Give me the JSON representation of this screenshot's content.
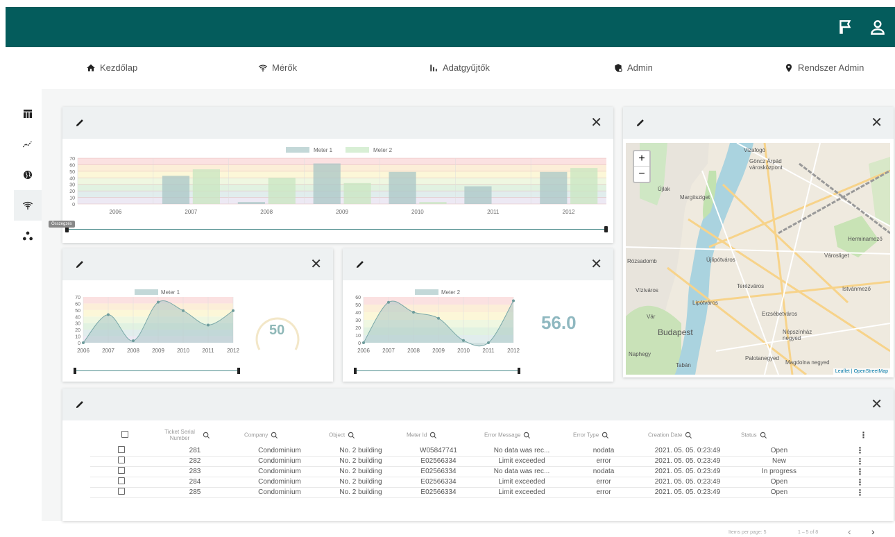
{
  "nav": {
    "items": [
      {
        "label": "Kezdőlap",
        "icon": "home-icon"
      },
      {
        "label": "Mérők",
        "icon": "wifi-signal-icon"
      },
      {
        "label": "Adatgyűjtők",
        "icon": "bar-chart-icon"
      },
      {
        "label": "Admin",
        "icon": "admin-gear-icon"
      },
      {
        "label": "Rendszer Admin",
        "icon": "location-pin-icon"
      }
    ]
  },
  "topbar": {
    "flag_icon": "flag-icon",
    "user_icon": "user-icon"
  },
  "colors": {
    "header": "#045c5c",
    "meter1": "#cfe1e1",
    "meter2": "#d8efd5"
  },
  "bar_card": {
    "slider_tooltip": "Összegzés"
  },
  "chart_data": [
    {
      "type": "bar",
      "categories": [
        "2006",
        "2007",
        "2008",
        "2009",
        "2010",
        "2011",
        "2012"
      ],
      "series": [
        {
          "name": "Meter 1",
          "values": [
            0,
            43,
            3,
            62,
            49,
            27,
            49
          ]
        },
        {
          "name": "Meter 2",
          "values": [
            0,
            53,
            40,
            32,
            3,
            0,
            55
          ]
        }
      ],
      "ylim": [
        0,
        70
      ],
      "yticks": [
        0,
        10,
        20,
        30,
        40,
        50,
        60,
        70
      ],
      "legend": "top-center"
    },
    {
      "type": "area",
      "categories": [
        "2006",
        "2007",
        "2008",
        "2009",
        "2010",
        "2011",
        "2012"
      ],
      "series": [
        {
          "name": "Meter 1",
          "values": [
            0,
            43,
            3,
            62,
            49,
            27,
            49
          ]
        }
      ],
      "ylim": [
        0,
        70
      ],
      "yticks": [
        0,
        10,
        20,
        30,
        40,
        50,
        60,
        70
      ],
      "gauge_value": "50",
      "legend": "top-center"
    },
    {
      "type": "area",
      "categories": [
        "2006",
        "2007",
        "2008",
        "2009",
        "2010",
        "2011",
        "2012"
      ],
      "series": [
        {
          "name": "Meter 2",
          "values": [
            0,
            53,
            40,
            32,
            3,
            0,
            55
          ]
        }
      ],
      "ylim": [
        0,
        60
      ],
      "yticks": [
        0,
        10,
        20,
        30,
        40,
        50,
        60
      ],
      "big_value": "56.0",
      "legend": "top-center"
    }
  ],
  "map": {
    "zoom_in": "+",
    "zoom_out": "−",
    "attribution": "Leaflet | OpenStreetMap",
    "labels": [
      "Vizafogó",
      "Göncz Árpád városközpont",
      "Újlak",
      "Margitsziget",
      "Újlipótváros",
      "Herminamező",
      "Városliget",
      "Terézváros",
      "Istvánmező",
      "Víziváros",
      "Lipótváros",
      "Erzsébetváros",
      "Budapest",
      "Vár",
      "Népszínház negyed",
      "Naphegy",
      "Tabán",
      "Palotanegyed",
      "Magdolna negyed",
      "Rózsadomb"
    ]
  },
  "table": {
    "headers": [
      "Ticket Serial Number",
      "Company",
      "Object",
      "Meter Id",
      "Error Message",
      "Error Type",
      "Creation Date",
      "Status"
    ],
    "rows": [
      [
        "281",
        "Condominium",
        "No. 2 building",
        "W05847741",
        "No data was rec...",
        "nodata",
        "2021. 05. 05. 0:23:49",
        "Open"
      ],
      [
        "282",
        "Condominium",
        "No. 2 building",
        "E02566334",
        "Limit exceeded",
        "error",
        "2021. 05. 05. 0:23:49",
        "New"
      ],
      [
        "283",
        "Condominium",
        "No. 2 building",
        "E02566334",
        "No data was rec...",
        "nodata",
        "2021. 05. 05. 0:23:49",
        "In progress"
      ],
      [
        "284",
        "Condominium",
        "No. 2 building",
        "E02566334",
        "Limit exceeded",
        "error",
        "2021. 05. 05. 0:23:49",
        "Open"
      ],
      [
        "285",
        "Condominium",
        "No. 2 building",
        "E02566334",
        "Limit exceeded",
        "error",
        "2021. 05. 05. 0:23:49",
        "Open"
      ]
    ],
    "items_per_page_label": "Items per page:",
    "items_per_page": "5",
    "range": "1 – 5 of 8"
  }
}
